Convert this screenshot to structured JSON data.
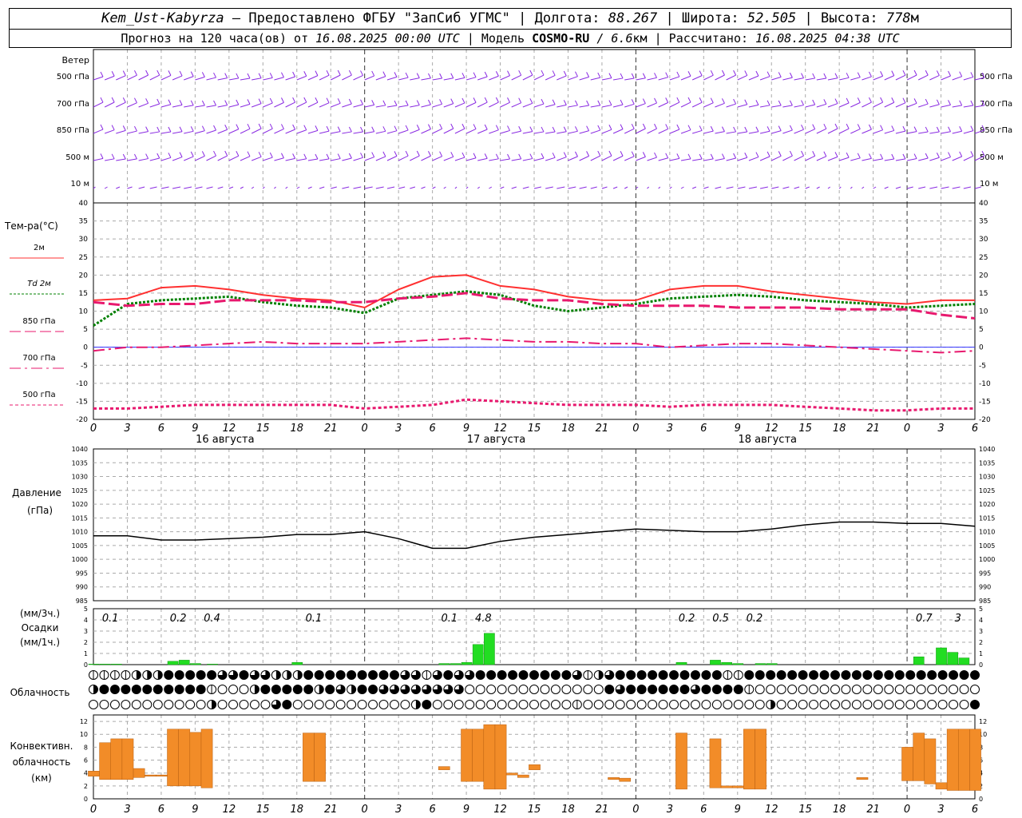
{
  "header": {
    "station": "Kem_Ust-Kabyrza",
    "provider": "— Предоставлено ФГБУ \"ЗапСиб УГМС\"",
    "lon_label": "Долгота:",
    "lon": "88.267",
    "lat_label": "Широта:",
    "lat": "52.505",
    "alt_label": "Высота:",
    "alt": "778",
    "alt_unit": "м",
    "forecast_prefix": "Прогноз на 120 часа(ов) от",
    "forecast_from": "16.08.2025 00:00 UTC",
    "model_label": "| Модель",
    "model": "COSMO-RU",
    "model_res": "/ 6.6",
    "model_res_unit": "км",
    "calc_label": "| Рассчитано:",
    "calc_time": "16.08.2025 04:38 UTC"
  },
  "time_axis": {
    "hour_labels": [
      "0",
      "3",
      "6",
      "9",
      "12",
      "15",
      "18",
      "21",
      "0",
      "3",
      "6",
      "9",
      "12",
      "15",
      "18",
      "21",
      "0",
      "3",
      "6",
      "9",
      "12",
      "15",
      "18",
      "21",
      "0",
      "3",
      "6"
    ],
    "date_labels": [
      "16 августа",
      "17 августа",
      "18 августа"
    ]
  },
  "wind": {
    "title": "Ветер",
    "levels": [
      "500 гПа",
      "700 гПа",
      "850 гПа",
      "500 м",
      "10  м"
    ],
    "color": "#8a2be2"
  },
  "colors": {
    "t2m": "#ff3030",
    "td2m": "#008000",
    "t850": "#e8196e",
    "t700": "#e8196e",
    "t500": "#e8196e",
    "pressure": "#000000",
    "precip": "#22dd22",
    "convective": "#f28c28",
    "zero_line": "#3030ff"
  },
  "chart_data": [
    {
      "type": "line",
      "title": "Тем-ра(°C)",
      "ylim": [
        -20,
        40
      ],
      "yticks": [
        "40",
        "35",
        "30",
        "25",
        "20",
        "15",
        "10",
        "5",
        "0",
        "-5",
        "-10",
        "-15",
        "-20"
      ],
      "x_hours": [
        0,
        3,
        6,
        9,
        12,
        15,
        18,
        21,
        24,
        27,
        30,
        33,
        36,
        39,
        42,
        45,
        48,
        51,
        54,
        57,
        60,
        63,
        66,
        69,
        72,
        75,
        78
      ],
      "series": [
        {
          "name": "2м",
          "key": "t2m",
          "values": [
            13,
            13.5,
            16.5,
            17,
            16,
            14.5,
            13.5,
            13,
            11,
            16,
            19.5,
            20,
            17,
            16,
            14,
            13,
            13,
            16,
            17,
            17,
            15.5,
            14.5,
            13.5,
            12.5,
            12,
            13,
            13
          ]
        },
        {
          "name": "Td 2м",
          "key": "td2m",
          "values": [
            6,
            12,
            13,
            13.5,
            14,
            12.5,
            11.5,
            11,
            9.5,
            13.5,
            14.5,
            15.5,
            14.5,
            11.5,
            10,
            11,
            12,
            13.5,
            14,
            14.5,
            14,
            13,
            12.5,
            12,
            11,
            11.5,
            12
          ]
        },
        {
          "name": "850 гПа",
          "key": "t850",
          "values": [
            12.5,
            11.5,
            12,
            12,
            13,
            13,
            13,
            12.5,
            12.5,
            13.5,
            14,
            15,
            13.5,
            13,
            13,
            12,
            11.5,
            11.5,
            11.5,
            11,
            11,
            11,
            10.5,
            10.5,
            10.5,
            9,
            8
          ]
        },
        {
          "name": "700 гПа",
          "key": "t700",
          "values": [
            -1,
            0,
            0,
            0.5,
            1,
            1.5,
            1,
            1,
            1,
            1.5,
            2,
            2.5,
            2,
            1.5,
            1.5,
            1,
            1,
            0,
            0.5,
            1,
            1,
            0.5,
            0,
            -0.5,
            -1,
            -1.5,
            -1
          ]
        },
        {
          "name": "500 гПа",
          "key": "t500",
          "values": [
            -17,
            -17,
            -16.5,
            -16,
            -16,
            -16,
            -16,
            -16,
            -17,
            -16.5,
            -16,
            -14.5,
            -15,
            -15.5,
            -16,
            -16,
            -16,
            -16.5,
            -16,
            -16,
            -16,
            -16.5,
            -17,
            -17.5,
            -17.5,
            -17,
            -17
          ]
        }
      ]
    },
    {
      "type": "line",
      "title": "Давление",
      "ylabel": "(гПа)",
      "ylim": [
        985,
        1040
      ],
      "yticks": [
        "1040",
        "1035",
        "1030",
        "1025",
        "1020",
        "1015",
        "1010",
        "1005",
        "1000",
        "995",
        "990",
        "985"
      ],
      "x_hours": [
        0,
        3,
        6,
        9,
        12,
        15,
        18,
        21,
        24,
        27,
        30,
        33,
        36,
        39,
        42,
        45,
        48,
        51,
        54,
        57,
        60,
        63,
        66,
        69,
        72,
        75,
        78
      ],
      "series": [
        {
          "name": "Давление",
          "key": "pressure",
          "values": [
            1008.5,
            1008.5,
            1007,
            1007,
            1007.5,
            1008,
            1009,
            1009,
            1010,
            1007.5,
            1004,
            1004,
            1006.5,
            1008,
            1009,
            1010,
            1011,
            1010.5,
            1010,
            1010,
            1011,
            1012.5,
            1013.5,
            1013.5,
            1013,
            1013,
            1012
          ]
        }
      ]
    },
    {
      "type": "bar",
      "title": "Осадки",
      "ylabel_top": "(мм/3ч.)",
      "ylabel_bottom": "(мм/1ч.)",
      "ylim": [
        0,
        5
      ],
      "yticks": [
        "5",
        "4",
        "3",
        "2",
        "1",
        "0"
      ],
      "x_hours": [
        0,
        1,
        2,
        7,
        8,
        9,
        18,
        10.5,
        31,
        32,
        33,
        34,
        35,
        52,
        55,
        56,
        57,
        59,
        60,
        73,
        75,
        76,
        77
      ],
      "values": [
        0.05,
        0.05,
        0.05,
        0.3,
        0.4,
        0.1,
        0.2,
        0.05,
        0.1,
        0.1,
        0.2,
        1.8,
        2.8,
        0.2,
        0.4,
        0.2,
        0.1,
        0.1,
        0.1,
        0.7,
        1.5,
        1.1,
        0.6
      ],
      "totals_3h": [
        {
          "hour": 1.5,
          "label": "0.1"
        },
        {
          "hour": 7.5,
          "label": "0.2"
        },
        {
          "hour": 10.5,
          "label": "0.4"
        },
        {
          "hour": 19.5,
          "label": "0.1"
        },
        {
          "hour": 31.5,
          "label": "0.1"
        },
        {
          "hour": 34.5,
          "label": "4.8"
        },
        {
          "hour": 52.5,
          "label": "0.2"
        },
        {
          "hour": 55.5,
          "label": "0.5"
        },
        {
          "hour": 58.5,
          "label": "0.2"
        },
        {
          "hour": 73.5,
          "label": "0.7"
        },
        {
          "hour": 76.5,
          "label": "3"
        }
      ]
    },
    {
      "type": "bar",
      "title": "Конвективн. облачность",
      "ylabel": "(км)",
      "ylim": [
        0,
        13
      ],
      "yticks": [
        "12",
        "10",
        "8",
        "6",
        "4",
        "2",
        "0"
      ],
      "bars": [
        {
          "hour": 0,
          "bottom": 3.5,
          "top": 4.3
        },
        {
          "hour": 1,
          "bottom": 3,
          "top": 8.7
        },
        {
          "hour": 2,
          "bottom": 3,
          "top": 9.3
        },
        {
          "hour": 3,
          "bottom": 3,
          "top": 9.3
        },
        {
          "hour": 4,
          "bottom": 3.3,
          "top": 4.7
        },
        {
          "hour": 5,
          "bottom": 3.5,
          "top": 3.7
        },
        {
          "hour": 6,
          "bottom": 3.5,
          "top": 3.7
        },
        {
          "hour": 7,
          "bottom": 2,
          "top": 10.8
        },
        {
          "hour": 8,
          "bottom": 2,
          "top": 10.8
        },
        {
          "hour": 9,
          "bottom": 2,
          "top": 10.3
        },
        {
          "hour": 10,
          "bottom": 1.7,
          "top": 10.8
        },
        {
          "hour": 19,
          "bottom": 2.7,
          "top": 10.2
        },
        {
          "hour": 20,
          "bottom": 2.7,
          "top": 10.2
        },
        {
          "hour": 31,
          "bottom": 4.5,
          "top": 5
        },
        {
          "hour": 33,
          "bottom": 2.7,
          "top": 10.8
        },
        {
          "hour": 34,
          "bottom": 2.7,
          "top": 10.8
        },
        {
          "hour": 35,
          "bottom": 1.5,
          "top": 11.5
        },
        {
          "hour": 36,
          "bottom": 1.5,
          "top": 11.5
        },
        {
          "hour": 37,
          "bottom": 3.7,
          "top": 4
        },
        {
          "hour": 38,
          "bottom": 3.3,
          "top": 3.7
        },
        {
          "hour": 39,
          "bottom": 4.5,
          "top": 5.3
        },
        {
          "hour": 46,
          "bottom": 3,
          "top": 3.3
        },
        {
          "hour": 47,
          "bottom": 2.7,
          "top": 3.2
        },
        {
          "hour": 52,
          "bottom": 1.5,
          "top": 10.2
        },
        {
          "hour": 55,
          "bottom": 1.7,
          "top": 9.3
        },
        {
          "hour": 56,
          "bottom": 1.7,
          "top": 2
        },
        {
          "hour": 57,
          "bottom": 1.7,
          "top": 2
        },
        {
          "hour": 58,
          "bottom": 1.5,
          "top": 10.8
        },
        {
          "hour": 59,
          "bottom": 1.5,
          "top": 10.8
        },
        {
          "hour": 68,
          "bottom": 3,
          "top": 3.3
        },
        {
          "hour": 72,
          "bottom": 2.8,
          "top": 8
        },
        {
          "hour": 73,
          "bottom": 2.8,
          "top": 10.2
        },
        {
          "hour": 74,
          "bottom": 2.3,
          "top": 9.3
        },
        {
          "hour": 75,
          "bottom": 1.5,
          "top": 2.5
        },
        {
          "hour": 76,
          "bottom": 1.3,
          "top": 10.8
        },
        {
          "hour": 77,
          "bottom": 1.3,
          "top": 10.8
        },
        {
          "hour": 78,
          "bottom": 1.3,
          "top": 10.8
        }
      ]
    },
    {
      "type": "table",
      "title": "Облачность",
      "rows": [
        "11112224444433433222444444444331343344444444431234444444444114444444444444444444444",
        "24444444444100024444424324433333333000000000000043444444344441000000000000000000000",
        "00000000000200000340000000000024000000000000010000000000000000020000000000000000004"
      ]
    }
  ]
}
